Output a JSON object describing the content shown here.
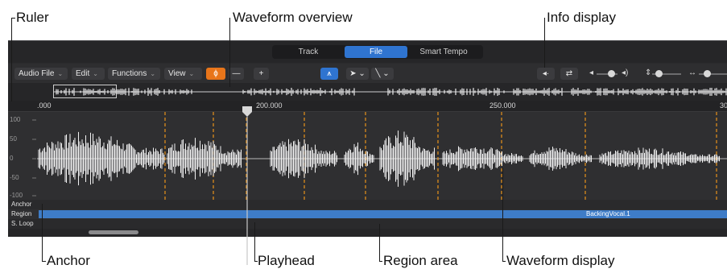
{
  "callouts": {
    "ruler": "Ruler",
    "waveform_overview": "Waveform overview",
    "info_display": "Info display",
    "anchor": "Anchor",
    "playhead": "Playhead",
    "region_area": "Region area",
    "waveform_display": "Waveform display"
  },
  "mode_tabs": [
    {
      "label": "Track",
      "active": false
    },
    {
      "label": "File",
      "active": true
    },
    {
      "label": "Smart Tempo",
      "active": false
    }
  ],
  "toolbar": {
    "menus": [
      "Audio File",
      "Edit",
      "Functions",
      "View"
    ],
    "zoom_out": "—",
    "zoom_in": "+",
    "icons": [
      "flex-icon",
      "catch-icon",
      "pointer-tool-icon",
      "pencil-tool-icon",
      "speaker-icon",
      "cycle-icon",
      "volume-low-icon",
      "volume-high-icon",
      "vertical-zoom-icon",
      "horizontal-zoom-icon"
    ]
  },
  "ruler": {
    "labels": [
      ".000",
      "200.000",
      "250.000",
      "30"
    ]
  },
  "amplitude_labels": [
    "100",
    "50",
    "0",
    "-50",
    "-100"
  ],
  "lanes": {
    "anchor": "Anchor",
    "region": "Region",
    "sloop": "S. Loop"
  },
  "region": {
    "name": "BackingVocal.1"
  },
  "colors": {
    "accent_blue": "#2f74d0",
    "orange": "#e8751a",
    "region_blue": "#3e7cc7",
    "marker_orange": "#e8931a"
  }
}
